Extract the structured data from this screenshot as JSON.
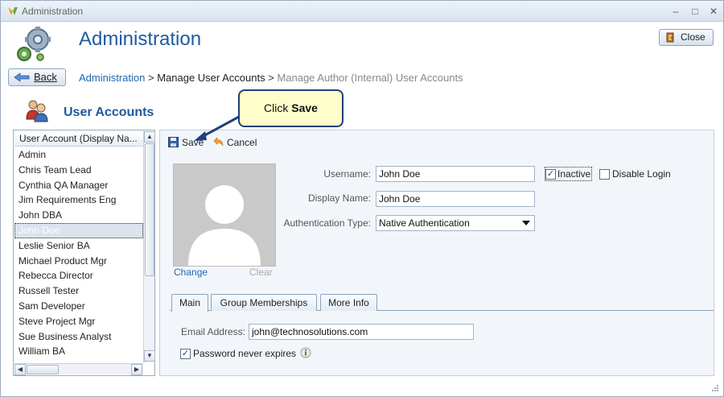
{
  "window": {
    "title": "Administration"
  },
  "header": {
    "title": "Administration",
    "close_label": "Close"
  },
  "nav": {
    "back_label": "Back",
    "breadcrumb": {
      "link": "Administration",
      "sep1": " > ",
      "current": "Manage User Accounts",
      "sep2": " > ",
      "muted": "Manage Author (Internal) User Accounts"
    }
  },
  "section": {
    "title": "User Accounts"
  },
  "user_list": {
    "header": "User Account (Display Na...",
    "items": [
      "Admin",
      "Chris Team Lead",
      "Cynthia QA Manager",
      "Jim Requirements Eng",
      "John DBA",
      "John Doe",
      "Leslie Senior BA",
      "Michael Product Mgr",
      "Rebecca Director",
      "Russell Tester",
      "Sam Developer",
      "Steve Project Mgr",
      "Sue Business Analyst",
      "William BA"
    ],
    "selected_index": 5
  },
  "toolbar": {
    "save_label": "Save",
    "cancel_label": "Cancel"
  },
  "callout": {
    "prefix": "Click ",
    "bold": "Save"
  },
  "photo": {
    "change_label": "Change",
    "clear_label": "Clear"
  },
  "form": {
    "username_label": "Username:",
    "username_value": "John Doe",
    "display_name_label": "Display Name:",
    "display_name_value": "John Doe",
    "auth_type_label": "Authentication Type:",
    "auth_type_value": "Native Authentication",
    "inactive_label": "Inactive",
    "inactive_checked": true,
    "disable_login_label": "Disable Login",
    "disable_login_checked": false
  },
  "tabs": [
    "Main",
    "Group Memberships",
    "More Info"
  ],
  "main_tab": {
    "email_label": "Email Address:",
    "email_value": "john@technosolutions.com",
    "password_never_expires_label": "Password never expires",
    "password_never_expires_checked": true
  },
  "colors": {
    "accent": "#1f5a9c",
    "link": "#1f66b0",
    "callout_bg": "#fffeca",
    "callout_border": "#1f3f7a"
  }
}
